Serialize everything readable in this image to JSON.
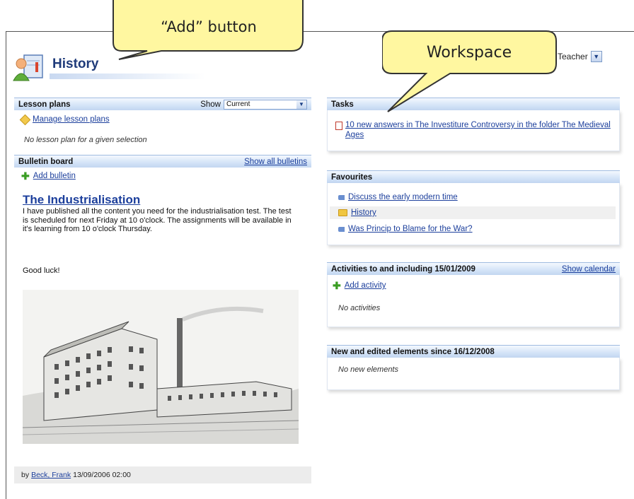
{
  "header": {
    "title": "History",
    "role": "Teacher"
  },
  "lesson_plans": {
    "title": "Lesson plans",
    "show_label": "Show",
    "show_value": "Current",
    "manage_link": "Manage lesson plans",
    "empty_note": "No lesson plan for a given selection"
  },
  "bulletin_board": {
    "title": "Bulletin board",
    "show_all": "Show all bulletins",
    "add_link": "Add bulletin",
    "post_title": "The Industrialisation",
    "post_body": "I have published all the content you need for the industrialisation test. The test is scheduled for next Friday at 10 o'clock. The assignments will be available in it's learning from 10 o'clock Thursday.",
    "post_closing": "Good luck!",
    "by_label": "by",
    "author": "Beck, Frank",
    "timestamp": "13/09/2006 02:00"
  },
  "tasks": {
    "title": "Tasks",
    "item": "10 new answers in The Investiture Controversy in the folder The Medieval Ages"
  },
  "favourites": {
    "title": "Favourites",
    "items": [
      {
        "label": "Discuss the early modern time",
        "icon": "tag-icon"
      },
      {
        "label": "History",
        "icon": "folder-icon"
      },
      {
        "label": "Was Princip to Blame for the War?",
        "icon": "tag-icon"
      }
    ]
  },
  "activities": {
    "title": "Activities to and including 15/01/2009",
    "show_calendar": "Show calendar",
    "add_link": "Add activity",
    "empty_note": "No activities"
  },
  "new_elements": {
    "title": "New and edited elements since 16/12/2008",
    "empty_note": "No new elements"
  },
  "callouts": {
    "add_button": "“Add” button",
    "workspace": "Workspace"
  },
  "colors": {
    "link": "#1c3f9c",
    "callout_fill": "#fff7a0",
    "panel_header": "#d6e5f8"
  }
}
